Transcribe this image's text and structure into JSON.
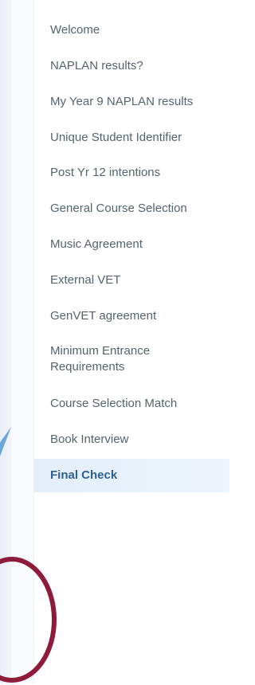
{
  "nav": {
    "items": [
      {
        "label": "Welcome"
      },
      {
        "label": "NAPLAN results?"
      },
      {
        "label": "My Year 9 NAPLAN results"
      },
      {
        "label": "Unique Student Identifier"
      },
      {
        "label": "Post Yr 12 intentions"
      },
      {
        "label": "General Course Selection"
      },
      {
        "label": "Music Agreement"
      },
      {
        "label": "External VET"
      },
      {
        "label": "GenVET agreement"
      },
      {
        "label": "Minimum Entrance Requirements"
      },
      {
        "label": "Course Selection Match"
      },
      {
        "label": "Book Interview"
      },
      {
        "label": "Final Check",
        "active": true
      }
    ]
  },
  "annotations": {
    "arrow_color": "#6aa6d8",
    "circle_color": "#8e1b3a"
  },
  "colors": {
    "text": "#556272",
    "active_text": "#2e5f92",
    "active_bg": "#e3eef9"
  }
}
